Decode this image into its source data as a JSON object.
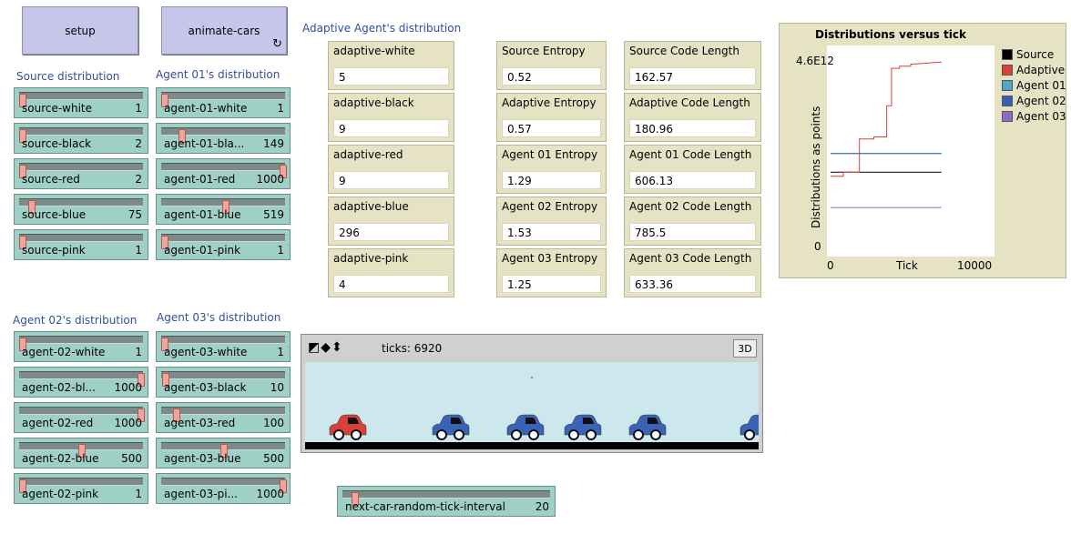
{
  "buttons": {
    "setup": "setup",
    "animate_cars": "animate-cars",
    "forever_icon": "forever-arrows-icon"
  },
  "section_titles": {
    "source": "Source distribution",
    "agent01": "Agent 01's distribution",
    "agent02": "Agent 02's distribution",
    "agent03": "Agent 03's distribution",
    "adaptive": "Adaptive Agent's distribution"
  },
  "sliders": {
    "source": [
      {
        "label": "source-white",
        "value": "1",
        "level": 0.0
      },
      {
        "label": "source-black",
        "value": "2",
        "level": 0.001
      },
      {
        "label": "source-red",
        "value": "2",
        "level": 0.001
      },
      {
        "label": "source-blue",
        "value": "75",
        "level": 0.075
      },
      {
        "label": "source-pink",
        "value": "1",
        "level": 0.0
      }
    ],
    "agent01": [
      {
        "label": "agent-01-white",
        "value": "1",
        "level": 0.0
      },
      {
        "label": "agent-01-bla...",
        "value": "149",
        "level": 0.149
      },
      {
        "label": "agent-01-red",
        "value": "1000",
        "level": 1.0
      },
      {
        "label": "agent-01-blue",
        "value": "519",
        "level": 0.519
      },
      {
        "label": "agent-01-pink",
        "value": "1",
        "level": 0.0
      }
    ],
    "agent02": [
      {
        "label": "agent-02-white",
        "value": "1",
        "level": 0.0
      },
      {
        "label": "agent-02-bl...",
        "value": "1000",
        "level": 1.0
      },
      {
        "label": "agent-02-red",
        "value": "1000",
        "level": 1.0
      },
      {
        "label": "agent-02-blue",
        "value": "500",
        "level": 0.5
      },
      {
        "label": "agent-02-pink",
        "value": "1",
        "level": 0.0
      }
    ],
    "agent03": [
      {
        "label": "agent-03-white",
        "value": "1",
        "level": 0.0
      },
      {
        "label": "agent-03-black",
        "value": "10",
        "level": 0.01
      },
      {
        "label": "agent-03-red",
        "value": "100",
        "level": 0.1
      },
      {
        "label": "agent-03-blue",
        "value": "500",
        "level": 0.5
      },
      {
        "label": "agent-03-pi...",
        "value": "1000",
        "level": 1.0
      }
    ],
    "interval": {
      "label": "next-car-random-tick-interval",
      "value": "20",
      "level": 0.02
    }
  },
  "adaptive_monitors": [
    {
      "label": "adaptive-white",
      "value": "5"
    },
    {
      "label": "adaptive-black",
      "value": "9"
    },
    {
      "label": "adaptive-red",
      "value": "9"
    },
    {
      "label": "adaptive-blue",
      "value": "296"
    },
    {
      "label": "adaptive-pink",
      "value": "4"
    }
  ],
  "entropy_monitors": [
    {
      "label": "Source Entropy",
      "value": "0.52"
    },
    {
      "label": "Adaptive Entropy",
      "value": "0.57"
    },
    {
      "label": "Agent 01 Entropy",
      "value": "1.29"
    },
    {
      "label": "Agent 02 Entropy",
      "value": "1.53"
    },
    {
      "label": "Agent 03 Entropy",
      "value": "1.25"
    }
  ],
  "codelength_monitors": [
    {
      "label": "Source Code Length",
      "value": "162.57"
    },
    {
      "label": "Adaptive Code Length",
      "value": "180.96"
    },
    {
      "label": "Agent 01 Code Length",
      "value": "606.13"
    },
    {
      "label": "Agent 02 Code Length",
      "value": "785.5"
    },
    {
      "label": "Agent 03 Code Length",
      "value": "633.36"
    }
  ],
  "view": {
    "ticks_label": "ticks: 6920",
    "three_d": "3D",
    "controls_icon": "view-control-arrows-icon"
  },
  "colors": {
    "source": "#000000",
    "adaptive": "#d7413a",
    "agent01": "#54a4cf",
    "agent02": "#3560b8",
    "agent03": "#9168c4",
    "red_car": "#d7413a",
    "blue_car": "#3a63b8"
  },
  "chart_data": {
    "type": "line",
    "title": "Distributions versus tick",
    "xlabel": "Tick",
    "ylabel": "Distributions as points",
    "xlim": [
      0,
      10000
    ],
    "ylim": [
      0,
      4600000000000.0
    ],
    "x_ticks": [
      "0",
      "10000"
    ],
    "y_ticks": [
      "0",
      "4.6E12"
    ],
    "legend_position": "right",
    "series": [
      {
        "name": "Source",
        "color": "#000000",
        "x": [
          0,
          6920
        ],
        "y": [
          1900000000000.0,
          1900000000000.0
        ]
      },
      {
        "name": "Adaptive",
        "color": "#d7413a",
        "x": [
          0,
          800,
          800,
          1800,
          1800,
          2700,
          2700,
          3500,
          3500,
          3800,
          3800,
          4300,
          4300,
          5000,
          5000,
          6920
        ],
        "y": [
          1800000000000.0,
          1800000000000.0,
          1900000000000.0,
          1900000000000.0,
          2700000000000.0,
          2700000000000.0,
          2750000000000.0,
          2750000000000.0,
          3500000000000.0,
          3500000000000.0,
          4400000000000.0,
          4400000000000.0,
          4450000000000.0,
          4450000000000.0,
          4500000000000.0,
          4550000000000.0
        ]
      },
      {
        "name": "Agent 01",
        "color": "#54a4cf",
        "x": [
          0,
          6920
        ],
        "y": [
          2350000000000.0,
          2350000000000.0
        ]
      },
      {
        "name": "Agent 02",
        "color": "#3560b8",
        "x": [
          0,
          6920
        ],
        "y": [
          2350000000000.0,
          2350000000000.0
        ]
      },
      {
        "name": "Agent 03",
        "color": "#9168c4",
        "x": [
          0,
          6920
        ],
        "y": [
          1050000000000.0,
          1050000000000.0
        ]
      }
    ]
  }
}
